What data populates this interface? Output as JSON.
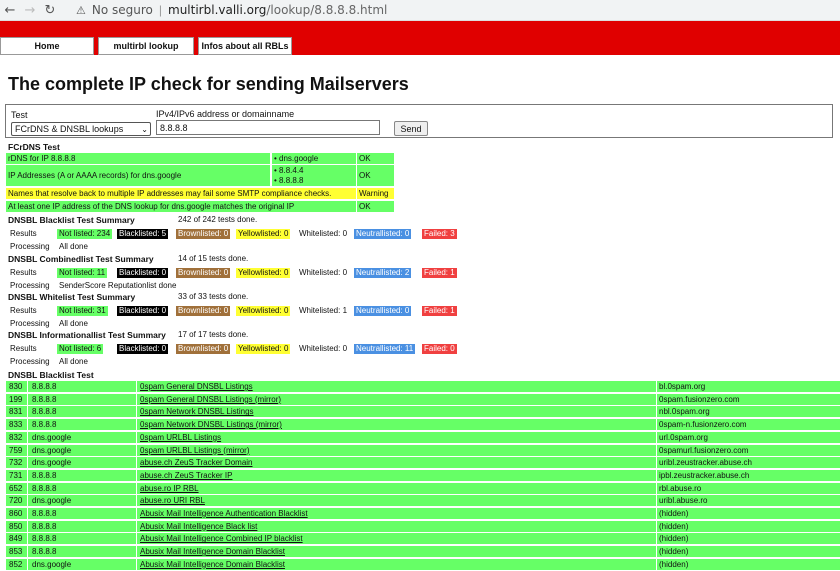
{
  "browser": {
    "security": "No seguro",
    "host": "multirbl.valli.org",
    "path": "/lookup/8.8.8.8.html"
  },
  "menu": {
    "home": "Home",
    "lookup": "multirbl lookup",
    "infos": "Infos about all RBLs"
  },
  "page_title": "The complete IP check for sending Mailservers",
  "form": {
    "test_label": "Test",
    "address_label": "IPv4/IPv6 address or domainname",
    "test_value": "FCrDNS & DNSBL lookups",
    "address_value": "8.8.8.8",
    "send_label": "Send"
  },
  "fcrdns": {
    "title": "FCrDNS Test",
    "rows": [
      {
        "label": "rDNS for IP 8.8.8.8",
        "values": [
          "dns.google"
        ],
        "result": "OK"
      },
      {
        "label": "IP Addresses (A or AAAA records) for dns.google",
        "values": [
          "8.8.4.4",
          "8.8.8.8"
        ],
        "result": "OK"
      }
    ],
    "warning_text": "Names that resolve back to multiple IP addresses may fail some SMTP compliance checks.",
    "warning_result": "Warning",
    "match_text": "At least one IP address of the DNS lookup for dns.google matches the original IP",
    "match_result": "OK"
  },
  "summaries": [
    {
      "title": "DNSBL Blacklist Test Summary",
      "done": "242 of 242 tests done.",
      "results_label": "Results",
      "not_listed": "Not listed: 234",
      "blacklisted": "Blacklisted: 5",
      "brownlisted": "Brownlisted: 0",
      "yellowlisted": "Yellowlisted: 0",
      "whitelisted": "Whitelisted: 0",
      "neutrallisted": "Neutrallisted: 0",
      "failed": "Failed: 3",
      "processing_label": "Processing",
      "processing": "All done"
    },
    {
      "title": "DNSBL Combinedlist Test Summary",
      "done": "14 of 15 tests done.",
      "results_label": "Results",
      "not_listed": "Not listed: 11",
      "blacklisted": "Blacklisted: 0",
      "brownlisted": "Brownlisted: 0",
      "yellowlisted": "Yellowlisted: 0",
      "whitelisted": "Whitelisted: 0",
      "neutrallisted": "Neutrallisted: 2",
      "failed": "Failed: 1",
      "processing_label": "Processing",
      "processing": "SenderScore Reputationlist done"
    },
    {
      "title": "DNSBL Whitelist Test Summary",
      "done": "33 of 33 tests done.",
      "results_label": "Results",
      "not_listed": "Not listed: 31",
      "blacklisted": "Blacklisted: 0",
      "brownlisted": "Brownlisted: 0",
      "yellowlisted": "Yellowlisted: 0",
      "whitelisted": "Whitelisted: 1",
      "neutrallisted": "Neutrallisted: 0",
      "failed": "Failed: 1",
      "processing_label": "Processing",
      "processing": "All done"
    },
    {
      "title": "DNSBL Informationallist Test Summary",
      "done": "17 of 17 tests done.",
      "results_label": "Results",
      "not_listed": "Not listed: 6",
      "blacklisted": "Blacklisted: 0",
      "brownlisted": "Brownlisted: 0",
      "yellowlisted": "Yellowlisted: 0",
      "whitelisted": "Whitelisted: 0",
      "neutrallisted": "Neutrallisted: 11",
      "failed": "Failed: 0",
      "processing_label": "Processing",
      "processing": "All done"
    }
  ],
  "blacklist_table": {
    "title": "DNSBL Blacklist Test",
    "rows": [
      {
        "id": "830",
        "query": "8.8.8.8",
        "name": "0spam General DNSBL Listings",
        "zone": "bl.0spam.org"
      },
      {
        "id": "199",
        "query": "8.8.8.8",
        "name": "0spam General DNSBL Listings (mirror)",
        "zone": "0spam.fusionzero.com"
      },
      {
        "id": "831",
        "query": "8.8.8.8",
        "name": "0spam Network DNSBL Listings",
        "zone": "nbl.0spam.org"
      },
      {
        "id": "833",
        "query": "8.8.8.8",
        "name": "0spam Network DNSBL Listings (mirror)",
        "zone": "0spam-n.fusionzero.com"
      },
      {
        "id": "832",
        "query": "dns.google",
        "name": "0spam URLBL Listings",
        "zone": "url.0spam.org"
      },
      {
        "id": "759",
        "query": "dns.google",
        "name": "0spam URLBL Listings (mirror)",
        "zone": "0spamurl.fusionzero.com"
      },
      {
        "id": "732",
        "query": "dns.google",
        "name": "abuse.ch ZeuS Tracker Domain",
        "zone": "uribl.zeustracker.abuse.ch"
      },
      {
        "id": "731",
        "query": "8.8.8.8",
        "name": "abuse.ch ZeuS Tracker IP",
        "zone": "ipbl.zeustracker.abuse.ch"
      },
      {
        "id": "652",
        "query": "8.8.8.8",
        "name": "abuse.ro IP RBL",
        "zone": "rbl.abuse.ro"
      },
      {
        "id": "720",
        "query": "dns.google",
        "name": "abuse.ro URI RBL",
        "zone": "uribl.abuse.ro"
      },
      {
        "id": "860",
        "query": "8.8.8.8",
        "name": "Abusix Mail Intelligence Authentication Blacklist",
        "zone": "(hidden)"
      },
      {
        "id": "850",
        "query": "8.8.8.8",
        "name": "Abusix Mail Intelligence Black list",
        "zone": "(hidden)"
      },
      {
        "id": "849",
        "query": "8.8.8.8",
        "name": "Abusix Mail Intelligence Combined IP blacklist",
        "zone": "(hidden)"
      },
      {
        "id": "853",
        "query": "8.8.8.8",
        "name": "Abusix Mail Intelligence Domain Blacklist",
        "zone": "(hidden)"
      },
      {
        "id": "852",
        "query": "dns.google",
        "name": "Abusix Mail Intelligence Domain Blacklist",
        "zone": "(hidden)"
      }
    ]
  }
}
